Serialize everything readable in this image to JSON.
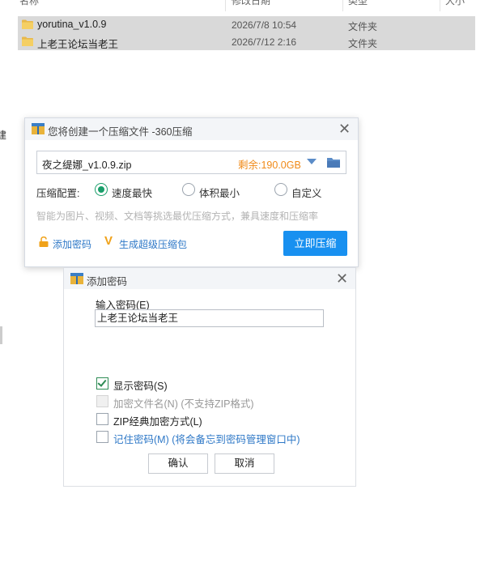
{
  "explorer": {
    "headers": {
      "name": "名称",
      "modified": "修改日期",
      "type": "类型",
      "size": "大小"
    },
    "files": [
      {
        "name": "yorutina_v1.0.9",
        "date": "2026/7/8 10:54",
        "type": "文件夹"
      },
      {
        "name": "上老王论坛当老王",
        "date": "2026/7/12 2:16",
        "type": "文件夹"
      }
    ],
    "edge_char": "建"
  },
  "compress_dialog": {
    "title": "您将创建一个压缩文件 -360压缩",
    "path_value": "夜之缇娜_v1.0.9.zip",
    "free_space": "剩余:190.0GB",
    "config_label": "压缩配置:",
    "options": [
      {
        "label": "速度最快",
        "selected": true
      },
      {
        "label": "体积最小",
        "selected": false
      },
      {
        "label": "自定义",
        "selected": false
      }
    ],
    "hint": "智能为图片、视频、文档等挑选最优压缩方式，兼具速度和压缩率",
    "add_password_link": "添加密码",
    "super_pack_link": "生成超级压缩包",
    "compress_button": "立即压缩"
  },
  "password_dialog": {
    "title": "添加密码",
    "input_label": "输入密码(E)",
    "password_value": "上老王论坛当老王",
    "checkboxes": [
      {
        "label": "显示密码(S)",
        "checked": true,
        "disabled": false
      },
      {
        "label": "加密文件名(N) (不支持ZIP格式)",
        "checked": false,
        "disabled": true
      },
      {
        "label": "ZIP经典加密方式(L)",
        "checked": false,
        "disabled": false
      },
      {
        "label": "记住密码(M) (将会备忘到密码管理窗口中)",
        "checked": false,
        "disabled": false
      }
    ],
    "ok_button": "确认",
    "cancel_button": "取消"
  },
  "colors": {
    "accent_blue": "#1890f0",
    "link_blue": "#2e78c7",
    "space_orange": "#f08a18",
    "radio_green": "#1a9e6a",
    "selection_gray": "#d9d9d9"
  }
}
